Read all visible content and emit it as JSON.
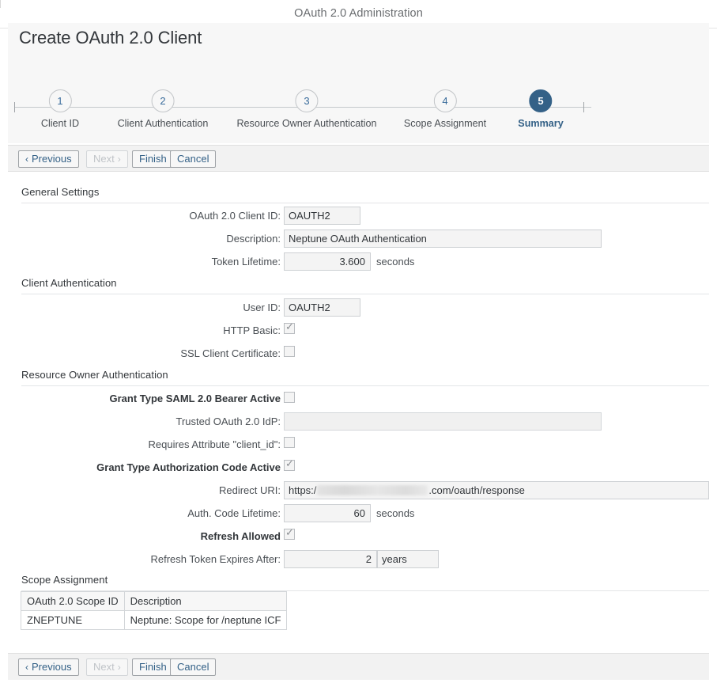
{
  "shell": {
    "title": "OAuth 2.0 Administration"
  },
  "page": {
    "title": "Create OAuth 2.0 Client"
  },
  "stepper": {
    "steps": [
      {
        "number": "1",
        "label": "Client ID",
        "active": false
      },
      {
        "number": "2",
        "label": "Client Authentication",
        "active": false
      },
      {
        "number": "3",
        "label": "Resource Owner Authentication",
        "active": false
      },
      {
        "number": "4",
        "label": "Scope Assignment",
        "active": false
      },
      {
        "number": "5",
        "label": "Summary",
        "active": true
      }
    ],
    "active_color": "#346187"
  },
  "toolbar": {
    "previous_label": "Previous",
    "next_label": "Next",
    "finish_label": "Finish",
    "cancel_label": "Cancel",
    "prev_chevron": "‹",
    "next_chevron": "›",
    "next_disabled": true
  },
  "sections": {
    "general": {
      "title": "General Settings",
      "client_id_label": "OAuth 2.0 Client ID:",
      "client_id_value": "OAUTH2",
      "description_label": "Description:",
      "description_value": "Neptune OAuth Authentication",
      "token_lifetime_label": "Token Lifetime:",
      "token_lifetime_value": "3.600",
      "token_lifetime_unit": "seconds"
    },
    "client_auth": {
      "title": "Client Authentication",
      "user_id_label": "User ID:",
      "user_id_value": "OAUTH2",
      "http_basic_label": "HTTP Basic:",
      "http_basic_checked": true,
      "ssl_cert_label": "SSL Client Certificate:",
      "ssl_cert_checked": false
    },
    "resource_owner": {
      "title": "Resource Owner Authentication",
      "saml_bearer_label": "Grant Type SAML 2.0 Bearer Active",
      "saml_bearer_checked": false,
      "trusted_idp_label": "Trusted OAuth 2.0 IdP:",
      "trusted_idp_value": "",
      "requires_attr_label": "Requires Attribute \"client_id\":",
      "requires_attr_checked": false,
      "auth_code_label": "Grant Type Authorization Code Active",
      "auth_code_checked": true,
      "redirect_uri_label": "Redirect URI:",
      "redirect_uri_prefix": "https:/",
      "redirect_uri_suffix": ".com/oauth/response",
      "redirect_uri_redacted": true,
      "auth_code_lifetime_label": "Auth. Code Lifetime:",
      "auth_code_lifetime_value": "60",
      "auth_code_lifetime_unit": "seconds",
      "refresh_allowed_label": "Refresh Allowed",
      "refresh_allowed_checked": true,
      "refresh_expires_label": "Refresh Token Expires After:",
      "refresh_expires_value": "2",
      "refresh_expires_unit": "years"
    },
    "scope": {
      "title": "Scope Assignment",
      "columns": [
        "OAuth 2.0 Scope ID",
        "Description"
      ],
      "rows": [
        {
          "scope_id": "ZNEPTUNE",
          "description": "Neptune: Scope for /neptune ICF"
        }
      ]
    }
  },
  "checkmark": "✓"
}
